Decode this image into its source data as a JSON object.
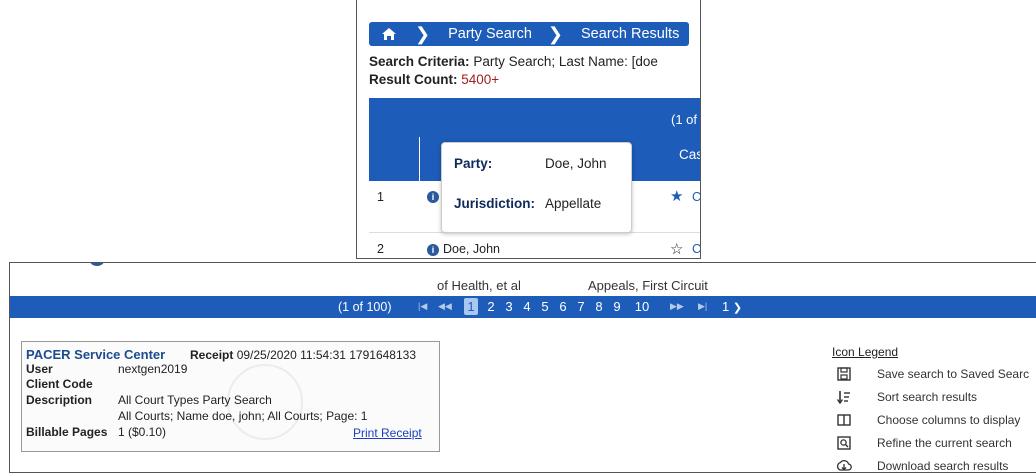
{
  "top": {
    "breadcrumbs": [
      "Party Search",
      "Search Results"
    ],
    "criteria_label": "Search Criteria:",
    "criteria_value": "Party Search; Last Name: [doe",
    "count_label": "Result Count:",
    "count_value": "5400+",
    "page_indicator": "(1 of",
    "column_header": "Cas",
    "tooltip": {
      "party_label": "Party:",
      "party_value": "Doe, John",
      "jurisdiction_label": "Jurisdiction:",
      "jurisdiction_value": "Appellate"
    },
    "rows": [
      {
        "num": "1",
        "letter": "C"
      },
      {
        "num": "2",
        "name": "Doe, John",
        "letter": "C"
      }
    ]
  },
  "bottom": {
    "cut_texts": [
      "of Health, et al",
      "Appeals, First Circuit"
    ],
    "pager": {
      "count": "(1 of 100)",
      "pages": [
        "1",
        "2",
        "3",
        "4",
        "5",
        "6",
        "7",
        "8",
        "9",
        "10"
      ],
      "current": "1",
      "select_value": "1"
    },
    "receipt": {
      "center": "PACER Service Center",
      "receipt_label": "Receipt",
      "receipt_value": "09/25/2020 11:54:31 1791648133",
      "user_label": "User",
      "user_value": "nextgen2019",
      "client_label": "Client Code",
      "desc_label": "Description",
      "desc_line1": "All Court Types Party Search",
      "desc_line2": "All Courts; Name doe, john; All Courts; Page: 1",
      "billable_label": "Billable Pages",
      "billable_value": "1 ($0.10)",
      "print_link": "Print Receipt"
    },
    "legend": {
      "title": "Icon Legend",
      "items": [
        {
          "icon": "save-icon",
          "label": "Save search to Saved Searc"
        },
        {
          "icon": "sort-icon",
          "label": "Sort search results"
        },
        {
          "icon": "columns-icon",
          "label": "Choose columns to display"
        },
        {
          "icon": "refine-icon",
          "label": "Refine the current search"
        },
        {
          "icon": "download-icon",
          "label": "Download search results"
        }
      ]
    }
  }
}
